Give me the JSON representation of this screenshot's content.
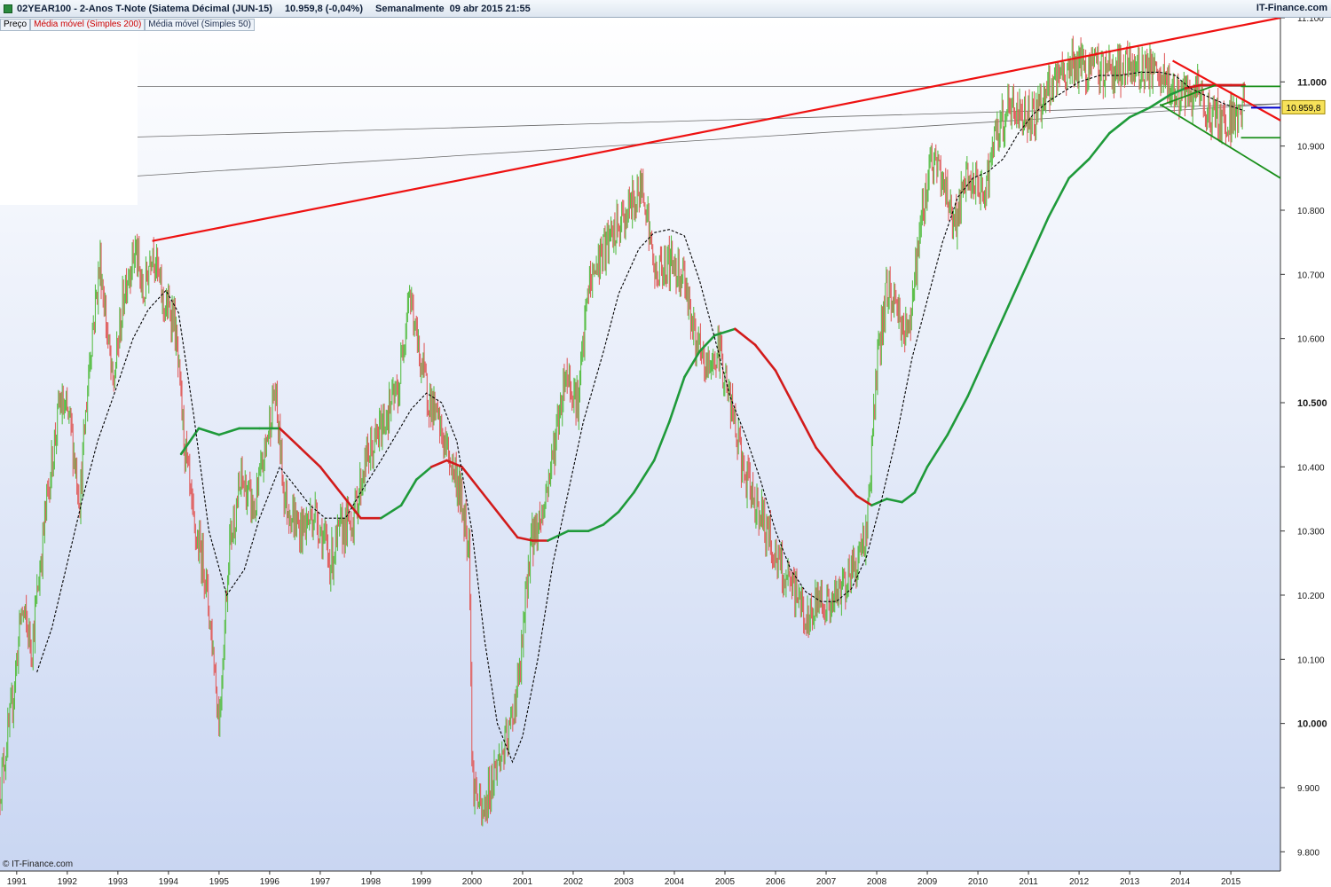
{
  "header": {
    "instrument": "02YEAR100 - 2-Anos T-Note (Siatema Décimal (JUN-15)",
    "price_change": "10.959,8 (-0,04%)",
    "period": "Semanalmente",
    "datetime": "09 abr 2015 21:55",
    "brand": "IT-Finance.com"
  },
  "legend": {
    "price": "Preço",
    "ma200": "Média móvel (Simples 200)",
    "ma50": "Média móvel (Simples 50)"
  },
  "footer": {
    "copyright": "© IT-Finance.com"
  },
  "colors": {
    "up_candle": "#5bbf4a",
    "down_candle": "#e06060",
    "ma200_up": "#1f9a3a",
    "ma200_down": "#d21b1b",
    "ma50": "#000000",
    "trend_red": "#ee1111",
    "trend_green": "#1a8f1a",
    "price_line": "#0000cc",
    "price_tag_bg": "#f7e25a",
    "background_top": "#ffffff",
    "background_bottom": "#c9d6f2"
  },
  "chart_data": {
    "type": "candlestick",
    "x_unit": "year",
    "xlim": [
      1990.67,
      2015.98
    ],
    "ylim": [
      9.77,
      11.1
    ],
    "y_ticks": [
      {
        "value": 11.1,
        "label": "11.100",
        "major": false
      },
      {
        "value": 11.0,
        "label": "11.000",
        "major": true
      },
      {
        "value": 10.9,
        "label": "10.900",
        "major": false
      },
      {
        "value": 10.8,
        "label": "10.800",
        "major": false
      },
      {
        "value": 10.7,
        "label": "10.700",
        "major": false
      },
      {
        "value": 10.6,
        "label": "10.600",
        "major": false
      },
      {
        "value": 10.5,
        "label": "10.500",
        "major": true
      },
      {
        "value": 10.4,
        "label": "10.400",
        "major": false
      },
      {
        "value": 10.3,
        "label": "10.300",
        "major": false
      },
      {
        "value": 10.2,
        "label": "10.200",
        "major": false
      },
      {
        "value": 10.1,
        "label": "10.100",
        "major": false
      },
      {
        "value": 10.0,
        "label": "10.000",
        "major": true
      },
      {
        "value": 9.9,
        "label": "9.900",
        "major": false
      },
      {
        "value": 9.8,
        "label": "9.800",
        "major": false
      }
    ],
    "x_ticks": [
      {
        "value": 1991,
        "label": "1991"
      },
      {
        "value": 1992,
        "label": "1992"
      },
      {
        "value": 1993,
        "label": "1993"
      },
      {
        "value": 1994,
        "label": "1994"
      },
      {
        "value": 1995,
        "label": "1995"
      },
      {
        "value": 1996,
        "label": "1996"
      },
      {
        "value": 1997,
        "label": "1997"
      },
      {
        "value": 1998,
        "label": "1998"
      },
      {
        "value": 1999,
        "label": "1999"
      },
      {
        "value": 2000,
        "label": "2000"
      },
      {
        "value": 2001,
        "label": "2001"
      },
      {
        "value": 2002,
        "label": "2002"
      },
      {
        "value": 2003,
        "label": "2003"
      },
      {
        "value": 2004,
        "label": "2004"
      },
      {
        "value": 2005,
        "label": "2005"
      },
      {
        "value": 2006,
        "label": "2006"
      },
      {
        "value": 2007,
        "label": "2007"
      },
      {
        "value": 2008,
        "label": "2008"
      },
      {
        "value": 2009,
        "label": "2009"
      },
      {
        "value": 2010,
        "label": "2010"
      },
      {
        "value": 2011,
        "label": "2011"
      },
      {
        "value": 2012,
        "label": "2012"
      },
      {
        "value": 2013,
        "label": "2013"
      },
      {
        "value": 2014,
        "label": "2014"
      },
      {
        "value": 2015,
        "label": "2015"
      }
    ],
    "price_path": [
      [
        1990.67,
        9.9
      ],
      [
        1990.9,
        10.02
      ],
      [
        1991.1,
        10.18
      ],
      [
        1991.3,
        10.12
      ],
      [
        1991.6,
        10.35
      ],
      [
        1991.85,
        10.5
      ],
      [
        1992.05,
        10.47
      ],
      [
        1992.25,
        10.35
      ],
      [
        1992.45,
        10.58
      ],
      [
        1992.65,
        10.72
      ],
      [
        1992.9,
        10.52
      ],
      [
        1993.15,
        10.69
      ],
      [
        1993.35,
        10.74
      ],
      [
        1993.5,
        10.66
      ],
      [
        1993.68,
        10.75
      ],
      [
        1993.9,
        10.65
      ],
      [
        1994.1,
        10.64
      ],
      [
        1994.3,
        10.45
      ],
      [
        1994.5,
        10.3
      ],
      [
        1994.7,
        10.25
      ],
      [
        1994.9,
        10.1
      ],
      [
        1995.0,
        10.0
      ],
      [
        1995.2,
        10.28
      ],
      [
        1995.45,
        10.38
      ],
      [
        1995.7,
        10.33
      ],
      [
        1995.9,
        10.42
      ],
      [
        1996.1,
        10.52
      ],
      [
        1996.3,
        10.35
      ],
      [
        1996.6,
        10.3
      ],
      [
        1996.9,
        10.33
      ],
      [
        1997.2,
        10.25
      ],
      [
        1997.4,
        10.3
      ],
      [
        1997.65,
        10.32
      ],
      [
        1997.9,
        10.41
      ],
      [
        1998.05,
        10.43
      ],
      [
        1998.3,
        10.48
      ],
      [
        1998.55,
        10.52
      ],
      [
        1998.75,
        10.68
      ],
      [
        1998.9,
        10.6
      ],
      [
        1999.1,
        10.52
      ],
      [
        1999.4,
        10.45
      ],
      [
        1999.7,
        10.38
      ],
      [
        1999.95,
        10.28
      ],
      [
        2000.0,
        9.92
      ],
      [
        2000.2,
        9.85
      ],
      [
        2000.45,
        9.93
      ],
      [
        2000.7,
        9.97
      ],
      [
        2000.95,
        10.08
      ],
      [
        2001.15,
        10.28
      ],
      [
        2001.4,
        10.33
      ],
      [
        2001.6,
        10.42
      ],
      [
        2001.85,
        10.55
      ],
      [
        2002.1,
        10.5
      ],
      [
        2002.3,
        10.68
      ],
      [
        2002.55,
        10.73
      ],
      [
        2002.8,
        10.76
      ],
      [
        2003.1,
        10.8
      ],
      [
        2003.4,
        10.84
      ],
      [
        2003.6,
        10.7
      ],
      [
        2003.9,
        10.72
      ],
      [
        2004.2,
        10.7
      ],
      [
        2004.4,
        10.6
      ],
      [
        2004.6,
        10.55
      ],
      [
        2004.9,
        10.58
      ],
      [
        2005.1,
        10.5
      ],
      [
        2005.4,
        10.38
      ],
      [
        2005.7,
        10.33
      ],
      [
        2005.95,
        10.27
      ],
      [
        2006.2,
        10.22
      ],
      [
        2006.45,
        10.2
      ],
      [
        2006.65,
        10.15
      ],
      [
        2006.85,
        10.2
      ],
      [
        2007.1,
        10.18
      ],
      [
        2007.35,
        10.22
      ],
      [
        2007.6,
        10.25
      ],
      [
        2007.8,
        10.3
      ],
      [
        2008.0,
        10.55
      ],
      [
        2008.2,
        10.68
      ],
      [
        2008.4,
        10.65
      ],
      [
        2008.6,
        10.6
      ],
      [
        2008.85,
        10.76
      ],
      [
        2009.05,
        10.88
      ],
      [
        2009.3,
        10.85
      ],
      [
        2009.55,
        10.78
      ],
      [
        2009.8,
        10.85
      ],
      [
        2010.1,
        10.82
      ],
      [
        2010.35,
        10.91
      ],
      [
        2010.6,
        10.96
      ],
      [
        2010.85,
        10.95
      ],
      [
        2011.1,
        10.95
      ],
      [
        2011.35,
        10.98
      ],
      [
        2011.6,
        11.0
      ],
      [
        2011.85,
        11.03
      ],
      [
        2012.1,
        11.02
      ],
      [
        2012.35,
        11.02
      ],
      [
        2012.6,
        11.02
      ],
      [
        2012.85,
        11.02
      ],
      [
        2013.1,
        11.02
      ],
      [
        2013.35,
        11.02
      ],
      [
        2013.6,
        11.0
      ],
      [
        2013.85,
        10.99
      ],
      [
        2014.1,
        10.97
      ],
      [
        2014.35,
        10.98
      ],
      [
        2014.6,
        10.95
      ],
      [
        2014.85,
        10.94
      ],
      [
        2015.1,
        10.95
      ],
      [
        2015.27,
        10.96
      ]
    ],
    "ma200": [
      [
        1994.25,
        10.42
      ],
      [
        1994.6,
        10.46
      ],
      [
        1995.0,
        10.45
      ],
      [
        1995.4,
        10.46
      ],
      [
        1995.8,
        10.46
      ],
      [
        1996.2,
        10.46
      ],
      [
        1996.6,
        10.43
      ],
      [
        1997.0,
        10.4
      ],
      [
        1997.4,
        10.36
      ],
      [
        1997.8,
        10.32
      ],
      [
        1998.2,
        10.32
      ],
      [
        1998.6,
        10.34
      ],
      [
        1998.9,
        10.38
      ],
      [
        1999.2,
        10.4
      ],
      [
        1999.5,
        10.41
      ],
      [
        1999.8,
        10.4
      ],
      [
        2000.2,
        10.36
      ],
      [
        2000.6,
        10.32
      ],
      [
        2000.9,
        10.29
      ],
      [
        2001.2,
        10.285
      ],
      [
        2001.5,
        10.285
      ],
      [
        2001.9,
        10.3
      ],
      [
        2002.3,
        10.3
      ],
      [
        2002.6,
        10.31
      ],
      [
        2002.9,
        10.33
      ],
      [
        2003.2,
        10.36
      ],
      [
        2003.6,
        10.41
      ],
      [
        2003.9,
        10.47
      ],
      [
        2004.2,
        10.54
      ],
      [
        2004.5,
        10.58
      ],
      [
        2004.8,
        10.605
      ],
      [
        2005.2,
        10.615
      ],
      [
        2005.6,
        10.59
      ],
      [
        2006.0,
        10.55
      ],
      [
        2006.4,
        10.49
      ],
      [
        2006.8,
        10.43
      ],
      [
        2007.2,
        10.39
      ],
      [
        2007.6,
        10.355
      ],
      [
        2007.9,
        10.34
      ],
      [
        2008.2,
        10.35
      ],
      [
        2008.5,
        10.345
      ],
      [
        2008.75,
        10.36
      ],
      [
        2009.0,
        10.4
      ],
      [
        2009.4,
        10.45
      ],
      [
        2009.8,
        10.51
      ],
      [
        2010.2,
        10.58
      ],
      [
        2010.6,
        10.65
      ],
      [
        2011.0,
        10.72
      ],
      [
        2011.4,
        10.79
      ],
      [
        2011.8,
        10.85
      ],
      [
        2012.2,
        10.88
      ],
      [
        2012.6,
        10.92
      ],
      [
        2013.0,
        10.945
      ],
      [
        2013.4,
        10.96
      ],
      [
        2013.8,
        10.98
      ],
      [
        2014.1,
        10.99
      ],
      [
        2014.4,
        10.995
      ],
      [
        2014.7,
        10.995
      ],
      [
        2015.0,
        10.995
      ],
      [
        2015.27,
        10.995
      ]
    ],
    "ma200_down_ranges": [
      [
        1996.2,
        1998.0
      ],
      [
        1999.3,
        2001.5
      ],
      [
        2005.35,
        2008.0
      ],
      [
        2014.2,
        2015.3
      ]
    ],
    "ma50": [
      [
        1991.4,
        10.08
      ],
      [
        1991.7,
        10.15
      ],
      [
        1992.0,
        10.25
      ],
      [
        1992.3,
        10.35
      ],
      [
        1992.6,
        10.44
      ],
      [
        1993.0,
        10.53
      ],
      [
        1993.3,
        10.6
      ],
      [
        1993.6,
        10.645
      ],
      [
        1993.95,
        10.675
      ],
      [
        1994.2,
        10.64
      ],
      [
        1994.5,
        10.48
      ],
      [
        1994.8,
        10.3
      ],
      [
        1995.15,
        10.2
      ],
      [
        1995.5,
        10.24
      ],
      [
        1995.8,
        10.32
      ],
      [
        1996.2,
        10.4
      ],
      [
        1996.5,
        10.37
      ],
      [
        1996.8,
        10.34
      ],
      [
        1997.1,
        10.32
      ],
      [
        1997.5,
        10.32
      ],
      [
        1997.8,
        10.36
      ],
      [
        1998.2,
        10.41
      ],
      [
        1998.5,
        10.45
      ],
      [
        1998.8,
        10.49
      ],
      [
        1999.1,
        10.515
      ],
      [
        1999.4,
        10.5
      ],
      [
        1999.7,
        10.44
      ],
      [
        2000.0,
        10.3
      ],
      [
        2000.25,
        10.13
      ],
      [
        2000.5,
        10.0
      ],
      [
        2000.8,
        9.94
      ],
      [
        2001.0,
        9.98
      ],
      [
        2001.3,
        10.1
      ],
      [
        2001.6,
        10.25
      ],
      [
        2001.9,
        10.36
      ],
      [
        2002.2,
        10.47
      ],
      [
        2002.6,
        10.58
      ],
      [
        2002.9,
        10.67
      ],
      [
        2003.3,
        10.74
      ],
      [
        2003.6,
        10.765
      ],
      [
        2003.9,
        10.77
      ],
      [
        2004.2,
        10.76
      ],
      [
        2004.5,
        10.69
      ],
      [
        2004.8,
        10.6
      ],
      [
        2005.1,
        10.51
      ],
      [
        2005.4,
        10.45
      ],
      [
        2005.7,
        10.38
      ],
      [
        2006.0,
        10.3
      ],
      [
        2006.3,
        10.24
      ],
      [
        2006.6,
        10.205
      ],
      [
        2006.9,
        10.19
      ],
      [
        2007.2,
        10.19
      ],
      [
        2007.5,
        10.21
      ],
      [
        2007.8,
        10.26
      ],
      [
        2008.1,
        10.35
      ],
      [
        2008.4,
        10.45
      ],
      [
        2008.7,
        10.57
      ],
      [
        2009.0,
        10.66
      ],
      [
        2009.3,
        10.75
      ],
      [
        2009.6,
        10.82
      ],
      [
        2009.9,
        10.85
      ],
      [
        2010.2,
        10.86
      ],
      [
        2010.5,
        10.88
      ],
      [
        2010.8,
        10.92
      ],
      [
        2011.1,
        10.95
      ],
      [
        2011.4,
        10.97
      ],
      [
        2011.7,
        10.985
      ],
      [
        2012.0,
        11.0
      ],
      [
        2012.4,
        11.01
      ],
      [
        2012.8,
        11.01
      ],
      [
        2013.2,
        11.015
      ],
      [
        2013.6,
        11.015
      ],
      [
        2013.9,
        11.01
      ],
      [
        2014.2,
        10.99
      ],
      [
        2014.6,
        10.975
      ],
      [
        2014.9,
        10.965
      ],
      [
        2015.27,
        10.955
      ]
    ],
    "trendlines": [
      {
        "color": "trend_red",
        "from": [
          1993.68,
          10.752
        ],
        "to": [
          2015.98,
          11.1
        ]
      },
      {
        "color": "trend_red",
        "from": [
          2013.85,
          11.033
        ],
        "to": [
          2015.98,
          10.94
        ]
      },
      {
        "color": "trend_green",
        "from": [
          2013.6,
          10.965
        ],
        "to": [
          2015.98,
          10.85
        ]
      },
      {
        "color": "trend_green",
        "from": [
          2013.6,
          10.963
        ],
        "to": [
          2014.7,
          10.995
        ]
      },
      {
        "color": "trend_green",
        "from": [
          2015.2,
          10.913
        ],
        "to": [
          2015.98,
          10.913
        ]
      },
      {
        "color": "trend_green",
        "from": [
          2015.2,
          10.993
        ],
        "to": [
          2015.98,
          10.993
        ]
      }
    ],
    "fib_lines": [
      {
        "from": [
          1992.9,
          10.993
        ],
        "to": [
          2015.98,
          10.993
        ]
      },
      {
        "from": [
          1992.9,
          10.913
        ],
        "to": [
          2015.98,
          10.966
        ]
      },
      {
        "from": [
          1992.9,
          10.851
        ],
        "to": [
          2015.98,
          10.966
        ]
      }
    ],
    "fib_handles": [
      [
        1993.15,
        10.993
      ],
      [
        1993.15,
        10.851
      ]
    ],
    "last_price": {
      "value": 10.9598,
      "label": "10.959,8"
    }
  }
}
